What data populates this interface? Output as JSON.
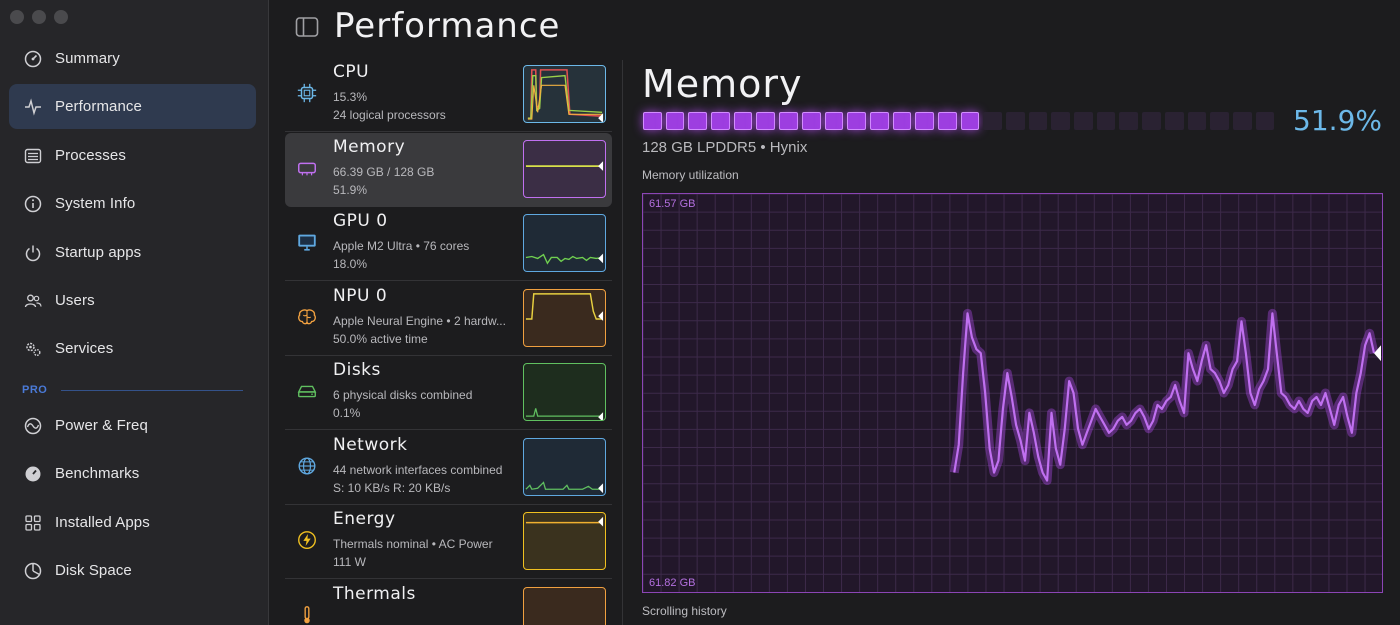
{
  "sidebar": {
    "items": [
      {
        "label": "Summary",
        "icon": "gauge-icon"
      },
      {
        "label": "Performance",
        "icon": "pulse-icon"
      },
      {
        "label": "Processes",
        "icon": "list-icon"
      },
      {
        "label": "System Info",
        "icon": "info-icon"
      },
      {
        "label": "Startup apps",
        "icon": "power-icon"
      },
      {
        "label": "Users",
        "icon": "users-icon"
      },
      {
        "label": "Services",
        "icon": "gears-icon"
      }
    ],
    "pro_label": "PRO",
    "pro_items": [
      {
        "label": "Power & Freq",
        "icon": "frequency-icon"
      },
      {
        "label": "Benchmarks",
        "icon": "speedometer-icon"
      },
      {
        "label": "Installed Apps",
        "icon": "apps-grid-icon"
      },
      {
        "label": "Disk Space",
        "icon": "pie-icon"
      }
    ],
    "active": "Performance"
  },
  "header": {
    "title": "Performance"
  },
  "resources": [
    {
      "title": "CPU",
      "sub1": "15.3%",
      "sub2": "24 logical processors",
      "color": "#6cb8e8",
      "icon": "cpu-icon"
    },
    {
      "title": "Memory",
      "sub1": "66.39 GB / 128 GB",
      "sub2": "51.9%",
      "color": "#c070f0",
      "icon": "memory-icon"
    },
    {
      "title": "GPU 0",
      "sub1": "Apple M2 Ultra • 76 cores",
      "sub2": "18.0%",
      "color": "#5fa8e0",
      "icon": "monitor-icon"
    },
    {
      "title": "NPU 0",
      "sub1": "Apple Neural Engine • 2 hardw...",
      "sub2": "50.0% active time",
      "color": "#f0a040",
      "icon": "brain-icon"
    },
    {
      "title": "Disks",
      "sub1": "6 physical disks combined",
      "sub2": "0.1%",
      "color": "#60c060",
      "icon": "disk-icon"
    },
    {
      "title": "Network",
      "sub1": "44 network interfaces combined",
      "sub2": "S: 10 KB/s  R: 20 KB/s",
      "color": "#5fa8e0",
      "icon": "globe-icon"
    },
    {
      "title": "Energy",
      "sub1": "Thermals nominal • AC Power",
      "sub2": "111 W",
      "color": "#f0c020",
      "icon": "bolt-icon"
    },
    {
      "title": "Thermals",
      "sub1": "",
      "sub2": "",
      "color": "#f0a040",
      "icon": "thermometer-icon"
    }
  ],
  "detail": {
    "title": "Memory",
    "percent": "51.9%",
    "blocks_total": 28,
    "blocks_filled": 15,
    "spec": "128 GB LPDDR5 • Hynix",
    "chart_label": "Memory utilization",
    "footer": "Scrolling history"
  },
  "chart_data": {
    "type": "line",
    "title": "Memory utilization",
    "ylabel_top": "61.57 GB",
    "ylabel_bottom": "61.82 GB",
    "grid": true,
    "series": [
      {
        "color": "#c070f0",
        "values": [
          null,
          null,
          null,
          null,
          null,
          null,
          null,
          null,
          null,
          null,
          null,
          null,
          null,
          null,
          null,
          null,
          null,
          null,
          null,
          null,
          null,
          null,
          null,
          null,
          null,
          null,
          null,
          null,
          null,
          null,
          null,
          null,
          null,
          null,
          null,
          null,
          null,
          null,
          null,
          null,
          null,
          null,
          null,
          null,
          null,
          null,
          null,
          null,
          null,
          null,
          null,
          null,
          null,
          null,
          null,
          null,
          null,
          null,
          null,
          null,
          null,
          null,
          null,
          null,
          null,
          null,
          null,
          null,
          null,
          null,
          0.3,
          0.37,
          0.55,
          0.7,
          0.64,
          0.61,
          0.6,
          0.5,
          0.36,
          0.3,
          0.33,
          0.46,
          0.55,
          0.49,
          0.42,
          0.38,
          0.33,
          0.45,
          0.4,
          0.34,
          0.3,
          0.28,
          0.45,
          0.36,
          0.32,
          0.41,
          0.53,
          0.5,
          0.41,
          0.37,
          0.4,
          0.43,
          0.46,
          0.44,
          0.42,
          0.4,
          0.41,
          0.43,
          0.44,
          0.42,
          0.43,
          0.45,
          0.46,
          0.44,
          0.41,
          0.43,
          0.47,
          0.46,
          0.48,
          0.49,
          0.52,
          0.48,
          0.45,
          0.6,
          0.56,
          0.53,
          0.58,
          0.62,
          0.56,
          0.55,
          0.53,
          0.5,
          0.52,
          0.56,
          0.58,
          0.68,
          0.6,
          0.5,
          0.47,
          0.51,
          0.53,
          0.56,
          0.7,
          0.6,
          0.5,
          0.49,
          0.47,
          0.46,
          0.48,
          0.46,
          0.45,
          0.48,
          0.49,
          0.47,
          0.5,
          0.46,
          0.42,
          0.47,
          0.49,
          0.44,
          0.4,
          0.5,
          0.55,
          0.62,
          0.65,
          0.6
        ]
      }
    ]
  }
}
